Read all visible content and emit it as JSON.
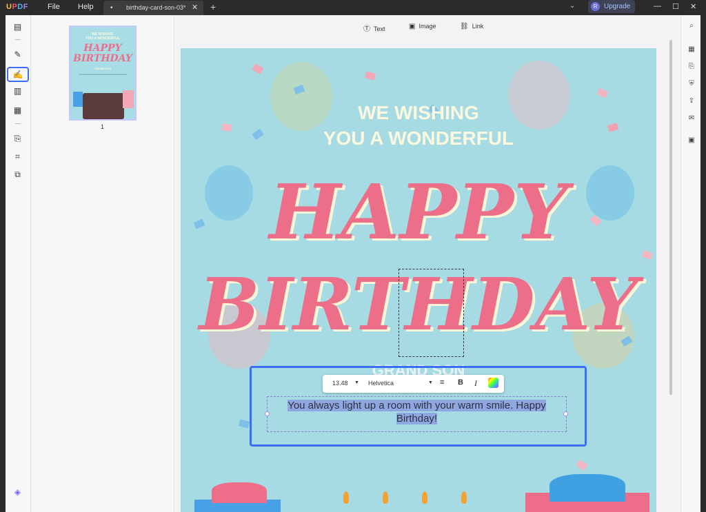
{
  "app": {
    "logo": "UPDF",
    "menu": [
      "File",
      "Help"
    ],
    "tab_title": "birthday-card-son-03*",
    "upgrade": "Upgrade",
    "avatar": "R"
  },
  "toolbar": {
    "text": "Text",
    "image": "Image",
    "link": "Link"
  },
  "thumbnails": {
    "page_number": "1"
  },
  "card": {
    "line1": "WE WISHING",
    "line2": "YOU A WONDERFUL",
    "happy": "HAPPY",
    "birthday": "BIRTHDAY",
    "grand": "GRAND SON",
    "selected_text": "You always light up a room with your warm smile. Happy Birthday!"
  },
  "format": {
    "font_size": "13.48",
    "font_name": "Helvetica",
    "bold": "B",
    "italic": "I"
  },
  "thumb_text": {
    "line1": "WE WISHING",
    "line2": "YOU A WONDERFUL",
    "happy": "HAPPY",
    "birthday": "BIRTHDAY",
    "grand": "GRAND SON"
  },
  "colors": {
    "accent": "#3b6ef5",
    "card_bg": "#a6dbe4",
    "pink": "#ed6e89",
    "cream": "#fbf8e0"
  }
}
